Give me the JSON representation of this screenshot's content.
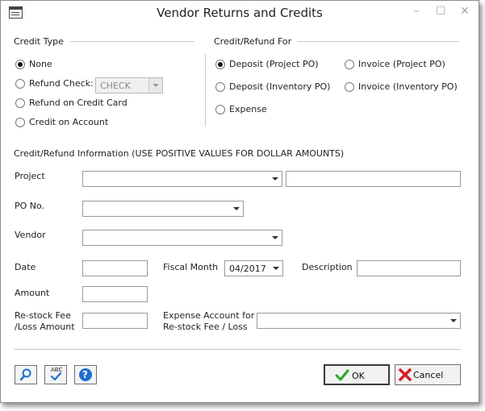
{
  "window": {
    "title": "Vendor Returns and Credits",
    "minimize": "–",
    "maximize": "☐",
    "close": "✕"
  },
  "credit_type": {
    "heading": "Credit Type",
    "options": [
      {
        "label": "None",
        "checked": true
      },
      {
        "label": "Refund Check:",
        "checked": false
      },
      {
        "label": "Refund on Credit Card",
        "checked": false
      },
      {
        "label": "Credit on Account",
        "checked": false
      }
    ],
    "check_combo_value": "CHECK"
  },
  "credit_refund_for": {
    "heading": "Credit/Refund For",
    "options": [
      {
        "label": "Deposit (Project PO)",
        "checked": true
      },
      {
        "label": "Deposit (Inventory PO)",
        "checked": false
      },
      {
        "label": "Expense",
        "checked": false
      },
      {
        "label": "Invoice (Project PO)",
        "checked": false
      },
      {
        "label": "Invoice (Inventory PO)",
        "checked": false
      }
    ]
  },
  "info": {
    "heading": "Credit/Refund Information (USE POSITIVE VALUES FOR DOLLAR AMOUNTS)",
    "project_label": "Project",
    "po_label": "PO No.",
    "vendor_label": "Vendor",
    "date_label": "Date",
    "fiscal_month_label": "Fiscal Month",
    "fiscal_month_value": "04/2017",
    "description_label": "Description",
    "amount_label": "Amount",
    "restock_label_line1": "Re-stock Fee",
    "restock_label_line2": "/Loss Amount",
    "expense_label_line1": "Expense Account for",
    "expense_label_line2": "Re-stock Fee / Loss"
  },
  "footer": {
    "ok_label": "OK",
    "cancel_label": "Cancel",
    "spell_icon_text": "ABC",
    "help_icon_text": "?"
  },
  "colors": {
    "accent_blue": "#1e6fd0",
    "ok_green": "#2aa62a",
    "cancel_red": "#d32020"
  }
}
